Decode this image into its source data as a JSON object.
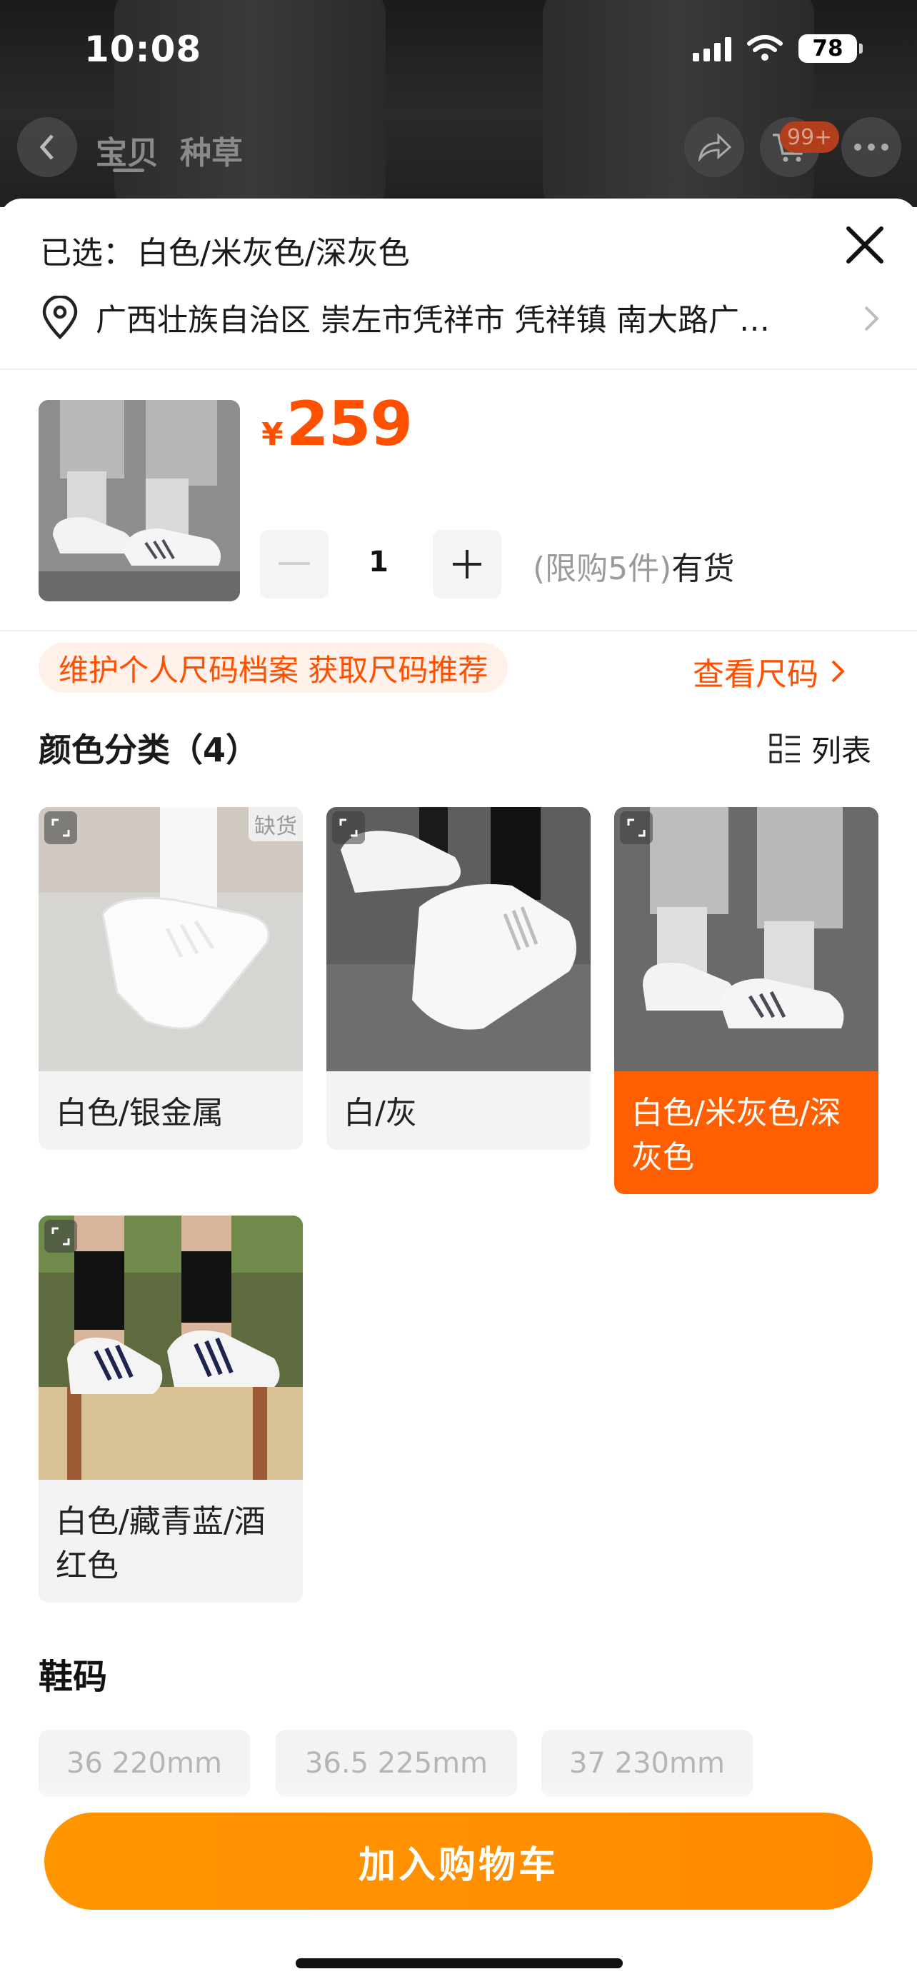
{
  "status_bar": {
    "time": "10:08",
    "battery": "78"
  },
  "background_nav": {
    "tab_item": "宝贝",
    "tab_seed": "种草",
    "cart_badge": "99+"
  },
  "selected": {
    "prefix": "已选：",
    "value": "白色/米灰色/深灰色"
  },
  "address": "广西壮族自治区 崇左市凭祥市 凭祥镇 南大路广…",
  "price": {
    "symbol": "¥",
    "value": "259"
  },
  "quantity": {
    "value": "1",
    "limit": "(限购5件)",
    "stock": "有货"
  },
  "size_profile": {
    "tip": "维护个人尺码档案 获取尺码推荐",
    "link": "查看尺码"
  },
  "color_section": {
    "title": "颜色分类（4）",
    "view_toggle": "列表"
  },
  "color_options": [
    {
      "label": "白色/银金属",
      "tag": "缺货",
      "selected": false
    },
    {
      "label": "白/灰",
      "selected": false
    },
    {
      "label": "白色/米灰色/深灰色",
      "selected": true
    },
    {
      "label": "白色/藏青蓝/酒红色",
      "selected": false
    }
  ],
  "shoe_size_section": {
    "title": "鞋码",
    "sizes": [
      "36 220mm",
      "36.5 225mm",
      "37 230mm"
    ]
  },
  "cta": {
    "label": "加入购物车"
  },
  "colors": {
    "accent": "#ff5000",
    "cta": "#ff8a00",
    "selected_card": "#ff5f00"
  }
}
